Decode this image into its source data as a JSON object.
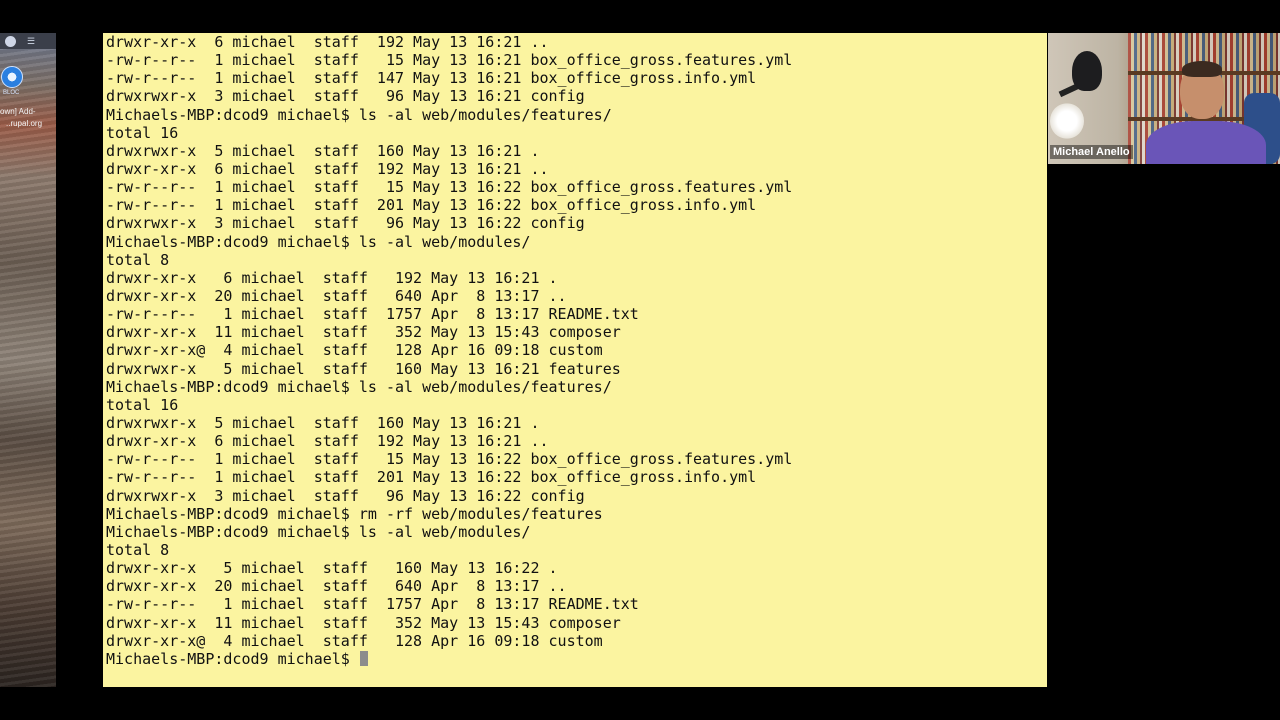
{
  "desktop": {
    "topbar_icon": "grid-icon",
    "safari_label": "BLOC",
    "tab_label_1": "own] Add-",
    "tab_label_2": "..rupal.org"
  },
  "terminal": {
    "background": "#fbf4a0",
    "prompt": "Michaels-MBP:dcod9 michael$ ",
    "lines": [
      "drwxr-xr-x  6 michael  staff  192 May 13 16:21 ..",
      "-rw-r--r--  1 michael  staff   15 May 13 16:21 box_office_gross.features.yml",
      "-rw-r--r--  1 michael  staff  147 May 13 16:21 box_office_gross.info.yml",
      "drwxrwxr-x  3 michael  staff   96 May 13 16:21 config",
      "Michaels-MBP:dcod9 michael$ ls -al web/modules/features/",
      "total 16",
      "drwxrwxr-x  5 michael  staff  160 May 13 16:21 .",
      "drwxr-xr-x  6 michael  staff  192 May 13 16:21 ..",
      "-rw-r--r--  1 michael  staff   15 May 13 16:22 box_office_gross.features.yml",
      "-rw-r--r--  1 michael  staff  201 May 13 16:22 box_office_gross.info.yml",
      "drwxrwxr-x  3 michael  staff   96 May 13 16:22 config",
      "Michaels-MBP:dcod9 michael$ ls -al web/modules/",
      "total 8",
      "drwxr-xr-x   6 michael  staff   192 May 13 16:21 .",
      "drwxr-xr-x  20 michael  staff   640 Apr  8 13:17 ..",
      "-rw-r--r--   1 michael  staff  1757 Apr  8 13:17 README.txt",
      "drwxr-xr-x  11 michael  staff   352 May 13 15:43 composer",
      "drwxr-xr-x@  4 michael  staff   128 Apr 16 09:18 custom",
      "drwxrwxr-x   5 michael  staff   160 May 13 16:21 features",
      "Michaels-MBP:dcod9 michael$ ls -al web/modules/features/",
      "total 16",
      "drwxrwxr-x  5 michael  staff  160 May 13 16:21 .",
      "drwxr-xr-x  6 michael  staff  192 May 13 16:21 ..",
      "-rw-r--r--  1 michael  staff   15 May 13 16:22 box_office_gross.features.yml",
      "-rw-r--r--  1 michael  staff  201 May 13 16:22 box_office_gross.info.yml",
      "drwxrwxr-x  3 michael  staff   96 May 13 16:22 config",
      "Michaels-MBP:dcod9 michael$ rm -rf web/modules/features",
      "Michaels-MBP:dcod9 michael$ ls -al web/modules/",
      "total 8",
      "drwxr-xr-x   5 michael  staff   160 May 13 16:22 .",
      "drwxr-xr-x  20 michael  staff   640 Apr  8 13:17 ..",
      "-rw-r--r--   1 michael  staff  1757 Apr  8 13:17 README.txt",
      "drwxr-xr-x  11 michael  staff   352 May 13 15:43 composer",
      "drwxr-xr-x@  4 michael  staff   128 Apr 16 09:18 custom"
    ]
  },
  "video": {
    "participant_name": "Michael Anello"
  }
}
